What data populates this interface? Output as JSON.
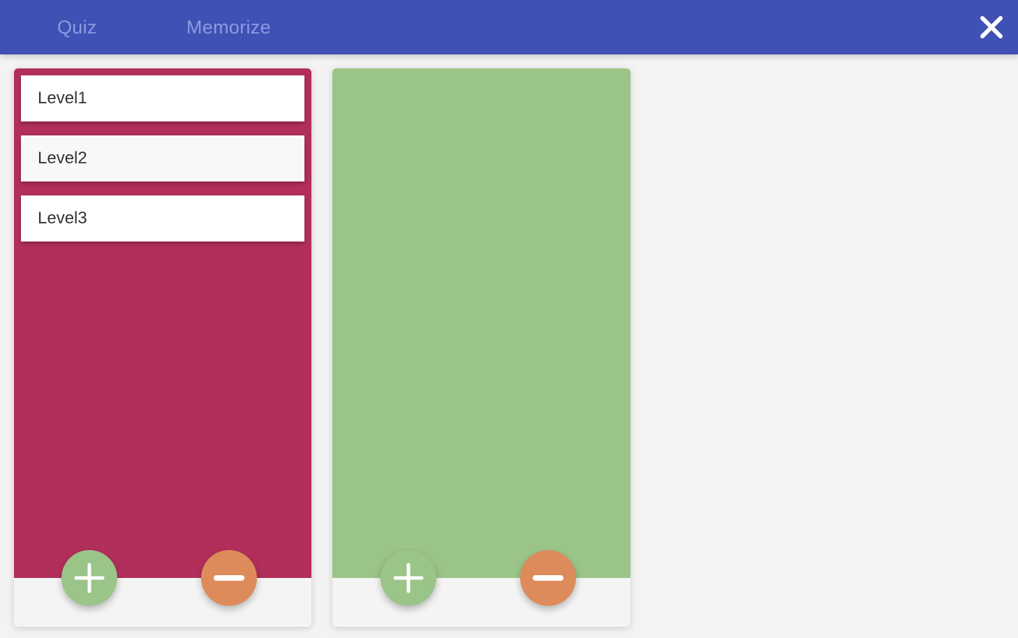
{
  "header": {
    "tabs": [
      {
        "label": "Quiz"
      },
      {
        "label": "Memorize"
      }
    ],
    "close_icon": "close-icon"
  },
  "colors": {
    "header": "#3f51b5",
    "tab_text": "#8d9ae0",
    "left_panel": "#b22f5b",
    "right_panel": "#9bc488",
    "add_button": "#9bc488",
    "remove_button": "#dd8b5b",
    "background": "#f3f3f3"
  },
  "left_panel": {
    "levels": [
      {
        "label": "Level1"
      },
      {
        "label": "Level2"
      },
      {
        "label": "Level3"
      }
    ],
    "add_icon": "plus-icon",
    "remove_icon": "minus-icon"
  },
  "right_panel": {
    "levels": [],
    "add_icon": "plus-icon",
    "remove_icon": "minus-icon"
  }
}
